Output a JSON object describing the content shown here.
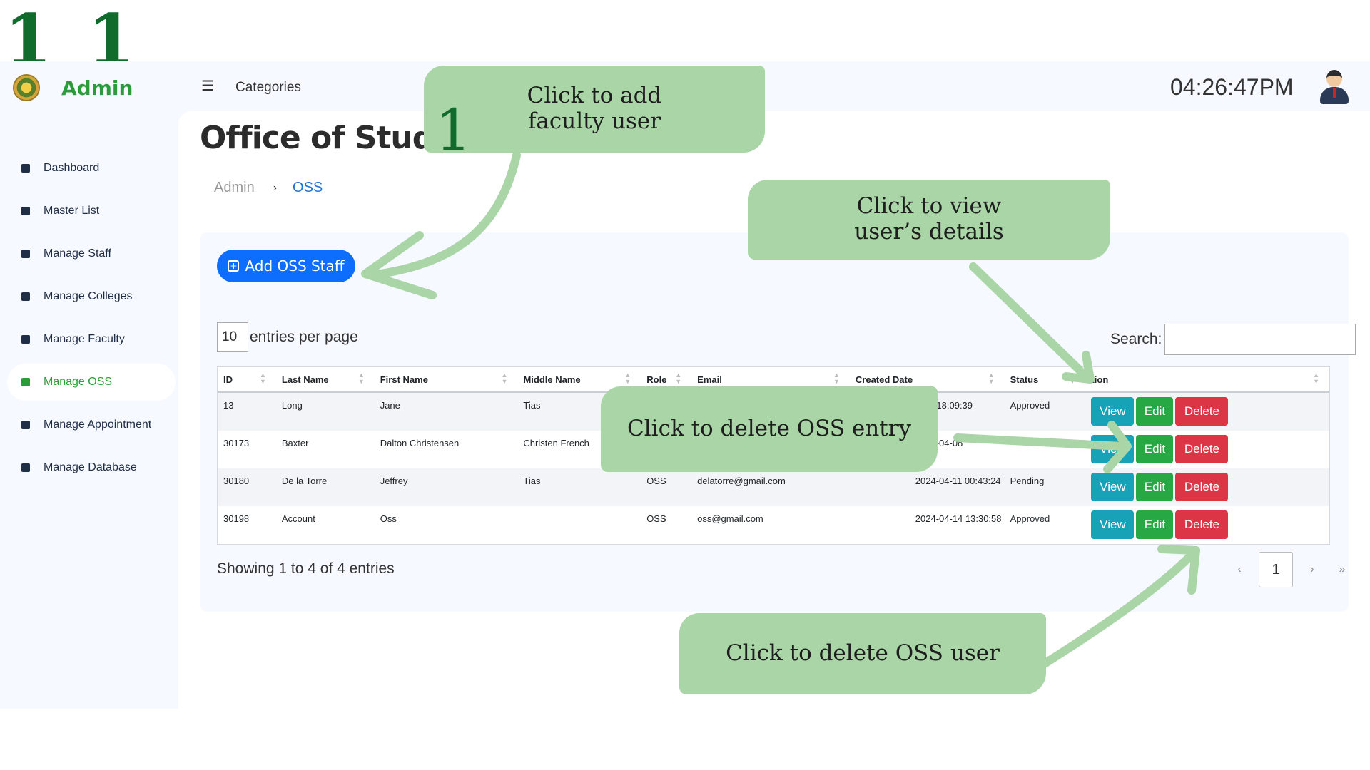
{
  "page_number": "1 1",
  "brand": {
    "title": "Admin",
    "logo": "seal-logo"
  },
  "sidebar": {
    "items": [
      {
        "label": "Dashboard",
        "icon": "grid-icon",
        "active": false
      },
      {
        "label": "Master List",
        "icon": "contact-icon",
        "active": false
      },
      {
        "label": "Manage Staff",
        "icon": "id-card-icon",
        "active": false
      },
      {
        "label": "Manage Colleges",
        "icon": "book-icon",
        "active": false
      },
      {
        "label": "Manage Faculty",
        "icon": "person-icon",
        "active": false
      },
      {
        "label": "Manage OSS",
        "icon": "person-list-icon",
        "active": true
      },
      {
        "label": "Manage Appointment",
        "icon": "calendar-icon",
        "active": false
      },
      {
        "label": "Manage Database",
        "icon": "database-icon",
        "active": false
      }
    ]
  },
  "topbar": {
    "menu_icon": "hamburger-icon",
    "categories": "Categories",
    "clock": "04:26:47PM",
    "avatar": "user-avatar"
  },
  "page": {
    "title": "Office of Stud",
    "breadcrumb": [
      "Admin",
      "OSS"
    ],
    "separator": "›"
  },
  "toolbar": {
    "add_label": "Add OSS Staff",
    "per_page_value": "10",
    "per_page_label": "entries per page",
    "search_label": "Search:"
  },
  "table": {
    "columns": [
      "ID",
      "Last Name",
      "First Name",
      "Middle Name",
      "Role",
      "Email",
      "Created Date",
      "Status",
      "tion"
    ],
    "rows": [
      {
        "id": "13",
        "last": "Long",
        "first": "Jane",
        "middle": "Tias",
        "role": "",
        "email": "",
        "date": "3-26 18:09:39",
        "status": "Approved"
      },
      {
        "id": "30173",
        "last": "Baxter",
        "first": "Dalton Christensen",
        "middle": "Christen French",
        "role": "",
        "email": "",
        "date": "2024-04-08",
        "status": ""
      },
      {
        "id": "30180",
        "last": "De la Torre",
        "first": "Jeffrey",
        "middle": "Tias",
        "role": "OSS",
        "email": "delatorre@gmail.com",
        "date": "2024-04-11 00:43:24",
        "status": "Pending"
      },
      {
        "id": "30198",
        "last": "Account",
        "first": "Oss",
        "middle": "",
        "role": "OSS",
        "email": "oss@gmail.com",
        "date": "2024-04-14 13:30:58",
        "status": "Approved"
      }
    ],
    "actions": {
      "view": "View",
      "edit": "Edit",
      "delete": "Delete"
    }
  },
  "footer": {
    "showing": "Showing 1 to 4 of 4 entries",
    "pager": {
      "prev": "‹",
      "current": "1",
      "next": "›",
      "last": "»"
    }
  },
  "annotations": {
    "add": "Click to add\nfaculty user",
    "view": "Click to view\nuser’s details",
    "delete_entry": "Click to delete OSS entry",
    "delete_user": "Click to delete OSS user",
    "mark": "1"
  },
  "colors": {
    "brand_green": "#2a9d3a",
    "primary": "#0d6efd",
    "view": "#17a2b8",
    "edit": "#28a745",
    "delete": "#dc3545",
    "annotation": "#a9d5a7"
  }
}
